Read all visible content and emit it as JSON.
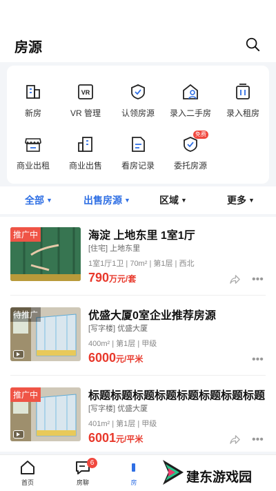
{
  "header": {
    "title": "房源"
  },
  "quick_actions": [
    {
      "label": "新房",
      "icon": "building-icon"
    },
    {
      "label": "VR 管理",
      "icon": "vr-icon"
    },
    {
      "label": "认领房源",
      "icon": "claim-shield-icon"
    },
    {
      "label": "录入二手房",
      "icon": "house-person-icon"
    },
    {
      "label": "录入租房",
      "icon": "rent-icon"
    },
    {
      "label": "商业出租",
      "icon": "shop-icon"
    },
    {
      "label": "商业出售",
      "icon": "office-icon"
    },
    {
      "label": "看房记录",
      "icon": "document-icon"
    },
    {
      "label": "委托房源",
      "icon": "entrust-shield-icon",
      "badge": "免费"
    }
  ],
  "filters": [
    {
      "label": "全部",
      "active": true
    },
    {
      "label": "出售房源",
      "active": true
    },
    {
      "label": "区域",
      "active": false
    },
    {
      "label": "更多",
      "active": false
    }
  ],
  "listings": [
    {
      "tag": "推广中",
      "title": "海淀 上地东里 1室1厅",
      "subtitle": "[住宅] 上地东里",
      "meta": "1室1厅1卫 | 70m² | 第1层 | 西北",
      "price": "790",
      "unit": "万元/套"
    },
    {
      "tag": "待推广",
      "title": "优盛大厦0室企业推荐房源",
      "subtitle": "[写字楼] 优盛大厦",
      "meta": "400m² | 第1层 | 甲级",
      "price": "6000",
      "unit": "元/平米"
    },
    {
      "tag": "推广中",
      "title": "标题标题标题标题标题标题标题标题",
      "subtitle": "[写字楼] 优盛大厦",
      "meta": "401m² | 第1层 | 甲级",
      "price": "6001",
      "unit": "元/平米"
    }
  ],
  "tabbar": {
    "home": "首页",
    "chat": "房聊",
    "chat_count": "6",
    "listings": "房"
  },
  "watermark": "建东游戏园",
  "colors": {
    "accent": "#2f6fe4",
    "price": "#e8392c",
    "tag": "#ef5446"
  }
}
